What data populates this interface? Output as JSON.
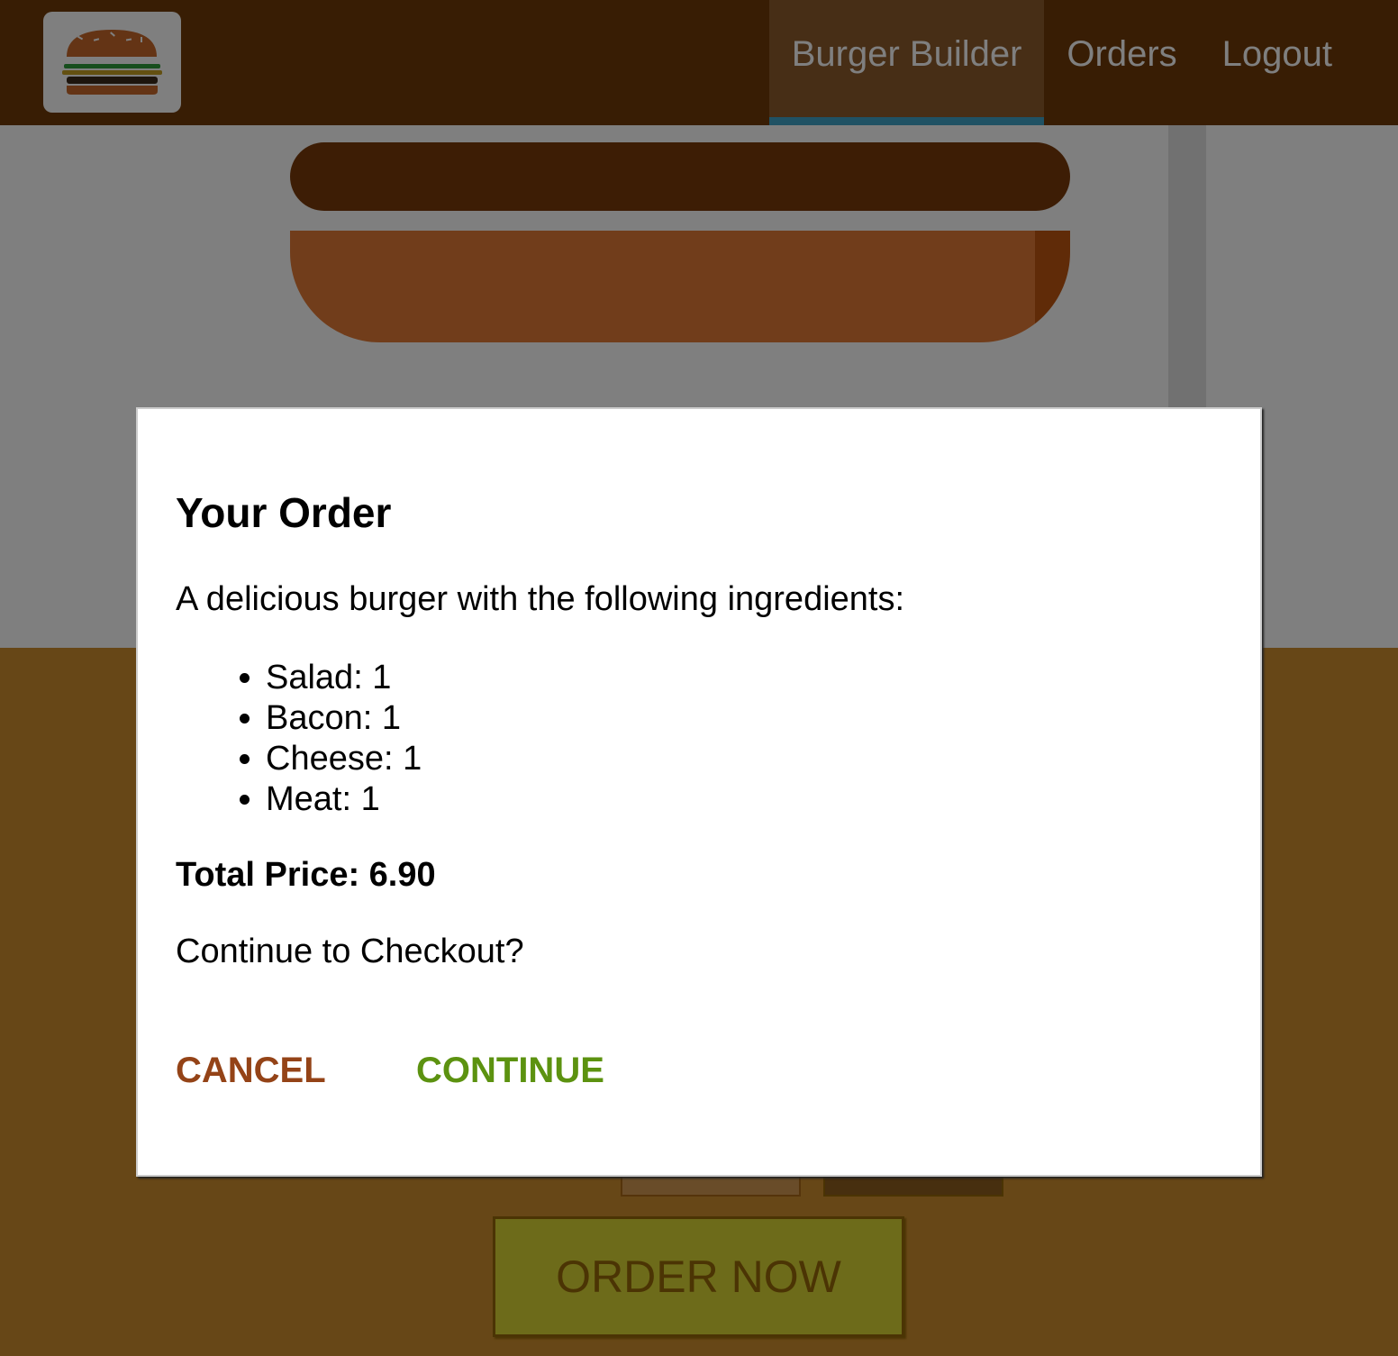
{
  "header": {
    "logo": "burger-logo",
    "nav": [
      {
        "label": "Burger Builder",
        "active": true
      },
      {
        "label": "Orders",
        "active": false
      },
      {
        "label": "Logout",
        "active": false
      }
    ]
  },
  "controls": {
    "order_button": "ORDER NOW"
  },
  "modal": {
    "title": "Your Order",
    "intro": "A delicious burger with the following ingredients:",
    "ingredients": [
      "Salad: 1",
      "Bacon: 1",
      "Cheese: 1",
      "Meat: 1"
    ],
    "total": "Total Price: 6.90",
    "question": "Continue to Checkout?",
    "cancel_label": "CANCEL",
    "continue_label": "CONTINUE"
  },
  "colors": {
    "toolbar": "#703b09",
    "nav_active_bg": "#8f5c2c",
    "nav_active_border": "#40a4c8",
    "controls_bg": "#cf8f2e",
    "order_button": "#dad735",
    "cancel": "#944317",
    "continue": "#5c9210"
  }
}
